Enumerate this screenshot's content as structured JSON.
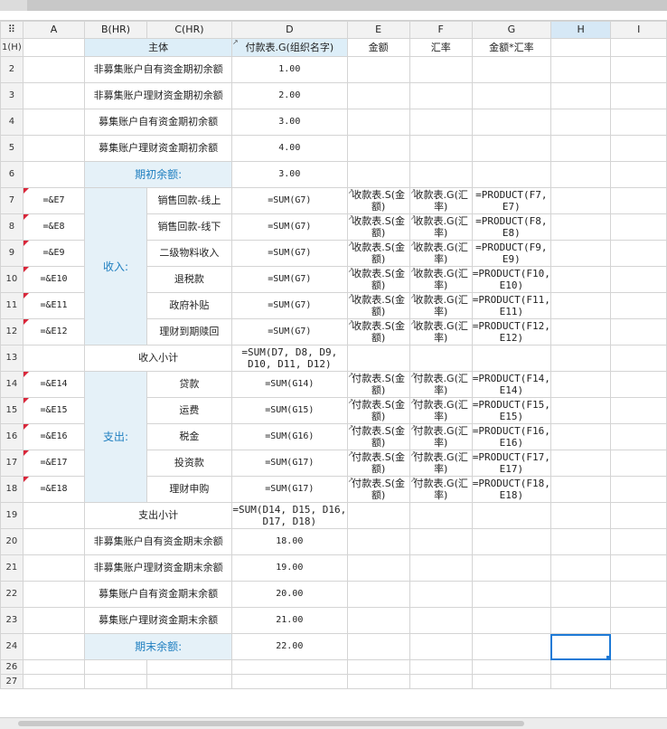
{
  "columns": {
    "corner": "⠿",
    "a": "A",
    "b": "B(HR)",
    "c": "C(HR)",
    "d": "D",
    "e": "E",
    "f": "F",
    "g": "G",
    "h": "H",
    "i": "I"
  },
  "header": {
    "row": "1(H)",
    "main": "主体",
    "d": "付款表.G(组织名字)",
    "e": "金额",
    "f": "汇率",
    "g": "金额*汇率"
  },
  "rows": {
    "r2": {
      "num": "2",
      "label": "非募集账户自有资金期初余额",
      "d": "1.00"
    },
    "r3": {
      "num": "3",
      "label": "非募集账户理财资金期初余额",
      "d": "2.00"
    },
    "r4": {
      "num": "4",
      "label": "募集账户自有资金期初余额",
      "d": "3.00"
    },
    "r5": {
      "num": "5",
      "label": "募集账户理财资金期初余额",
      "d": "4.00"
    },
    "r6": {
      "num": "6",
      "label": "期初余额:",
      "d": "3.00"
    },
    "r7": {
      "num": "7",
      "a": "=&E7",
      "c": "销售回款-线上",
      "d": "=SUM(G7)",
      "e": "收款表.S(金额)",
      "f": "收款表.G(汇率)",
      "g": "=PRODUCT(F7, E7)"
    },
    "r8": {
      "num": "8",
      "a": "=&E8",
      "c": "销售回款-线下",
      "d": "=SUM(G7)",
      "e": "收款表.S(金额)",
      "f": "收款表.G(汇率)",
      "g": "=PRODUCT(F8, E8)"
    },
    "r9": {
      "num": "9",
      "a": "=&E9",
      "c": "二级物料收入",
      "d": "=SUM(G7)",
      "e": "收款表.S(金额)",
      "f": "收款表.G(汇率)",
      "g": "=PRODUCT(F9, E9)"
    },
    "r10": {
      "num": "10",
      "a": "=&E10",
      "c": "退税款",
      "d": "=SUM(G7)",
      "e": "收款表.S(金额)",
      "f": "收款表.G(汇率)",
      "g": "=PRODUCT(F10, E10)"
    },
    "r11": {
      "num": "11",
      "a": "=&E11",
      "c": "政府补贴",
      "d": "=SUM(G7)",
      "e": "收款表.S(金额)",
      "f": "收款表.G(汇率)",
      "g": "=PRODUCT(F11, E11)"
    },
    "r12": {
      "num": "12",
      "a": "=&E12",
      "c": "理财到期赎回",
      "d": "=SUM(G7)",
      "e": "收款表.S(金额)",
      "f": "收款表.G(汇率)",
      "g": "=PRODUCT(F12, E12)"
    },
    "r13": {
      "num": "13",
      "label": "收入小计",
      "d": "=SUM(D7, D8, D9, D10, D11, D12)"
    },
    "r14": {
      "num": "14",
      "a": "=&E14",
      "c": "贷款",
      "d": "=SUM(G14)",
      "e": "付款表.S(金额)",
      "f": "付款表.G(汇率)",
      "g": "=PRODUCT(F14, E14)"
    },
    "r15": {
      "num": "15",
      "a": "=&E15",
      "c": "运费",
      "d": "=SUM(G15)",
      "e": "付款表.S(金额)",
      "f": "付款表.G(汇率)",
      "g": "=PRODUCT(F15, E15)"
    },
    "r16": {
      "num": "16",
      "a": "=&E16",
      "c": "税金",
      "d": "=SUM(G16)",
      "e": "付款表.S(金额)",
      "f": "付款表.G(汇率)",
      "g": "=PRODUCT(F16, E16)"
    },
    "r17": {
      "num": "17",
      "a": "=&E17",
      "c": "投资款",
      "d": "=SUM(G17)",
      "e": "付款表.S(金额)",
      "f": "付款表.G(汇率)",
      "g": "=PRODUCT(F17, E17)"
    },
    "r18": {
      "num": "18",
      "a": "=&E18",
      "c": "理财申购",
      "d": "=SUM(G17)",
      "e": "付款表.S(金额)",
      "f": "付款表.G(汇率)",
      "g": "=PRODUCT(F18, E18)"
    },
    "r19": {
      "num": "19",
      "label": "支出小计",
      "d": "=SUM(D14, D15, D16, D17, D18)"
    },
    "r20": {
      "num": "20",
      "label": "非募集账户自有资金期末余额",
      "d": "18.00"
    },
    "r21": {
      "num": "21",
      "label": "非募集账户理财资金期末余额",
      "d": "19.00"
    },
    "r22": {
      "num": "22",
      "label": "募集账户自有资金期末余额",
      "d": "20.00"
    },
    "r23": {
      "num": "23",
      "label": "募集账户理财资金期末余额",
      "d": "21.00"
    },
    "r24": {
      "num": "24",
      "label": "期末余额:",
      "d": "22.00"
    },
    "r26": {
      "num": "26"
    },
    "r27": {
      "num": "27"
    }
  },
  "groups": {
    "income": "收入:",
    "expense": "支出:"
  }
}
